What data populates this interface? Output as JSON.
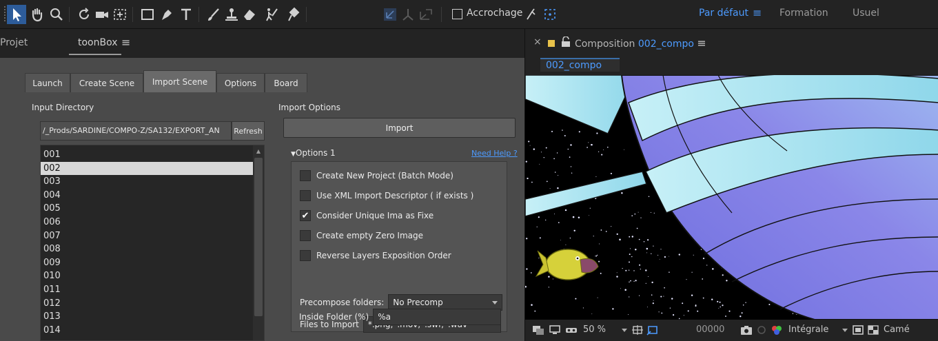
{
  "toolbar": {
    "snapping_label": "Accrochage",
    "workspaces": [
      {
        "label": "Par défaut",
        "active": true
      },
      {
        "label": "Formation",
        "active": false
      },
      {
        "label": "Usuel",
        "active": false
      }
    ],
    "icons": [
      "selection-tool-icon",
      "hand-tool-icon",
      "zoom-tool-icon",
      "rotate-tool-icon",
      "camera-tool-icon",
      "pan-behind-icon",
      "rectangle-tool-icon",
      "pen-tool-icon",
      "type-tool-icon",
      "brush-tool-icon",
      "clone-stamp-icon",
      "eraser-tool-icon",
      "roto-brush-icon",
      "puppet-pin-icon"
    ]
  },
  "left_panel": {
    "tabs": [
      {
        "label": "Projet",
        "active": false
      },
      {
        "label": "toonBox",
        "active": true
      }
    ],
    "inner_tabs": [
      {
        "label": "Launch",
        "active": false
      },
      {
        "label": "Create Scene",
        "active": false
      },
      {
        "label": "Import Scene",
        "active": true
      },
      {
        "label": "Options",
        "active": false
      },
      {
        "label": "Board",
        "active": false
      }
    ],
    "input_directory": {
      "label": "Input Directory",
      "path": "/_Prods/SARDINE/COMPO-Z/SA132/EXPORT_AN",
      "refresh_label": "Refresh"
    },
    "items": [
      "001",
      "002",
      "003",
      "004",
      "005",
      "006",
      "007",
      "008",
      "009",
      "010",
      "011",
      "012",
      "013",
      "014"
    ],
    "selected_item": "002",
    "import_options": {
      "label": "Import Options",
      "import_button": "Import",
      "options_title": "Options 1",
      "help_link": "Need Help ?",
      "checkboxes": [
        {
          "label": "Create New Project (Batch Mode)",
          "checked": false
        },
        {
          "label": "Use XML Import Descriptor ( if exists )",
          "checked": false
        },
        {
          "label": "Consider Unique Ima as Fixe",
          "checked": true
        },
        {
          "label": "Create empty Zero  Image",
          "checked": false
        },
        {
          "label": "Reverse Layers Exposition Order",
          "checked": false
        }
      ],
      "precompose_label": "Precompose folders:",
      "precompose_value": "No Precomp",
      "files_label": "Files to Import",
      "files_value": "*.png,*.mov,*.swf,*.wav",
      "inside_folder_label": "Inside Folder (%)",
      "inside_folder_value": "%a"
    }
  },
  "composition": {
    "title_prefix": "Composition",
    "name": "002_compo",
    "tab_label": "002_compo",
    "viewer_bar": {
      "zoom": "50 %",
      "timecode": "00000",
      "resolution": "Intégrale",
      "camera": "Camé"
    }
  },
  "colors": {
    "accent_blue": "#4d9bff",
    "swatch": "#e8c24a",
    "planet_dark": "#6f6fe0",
    "planet_light": "#a9e3f2"
  }
}
